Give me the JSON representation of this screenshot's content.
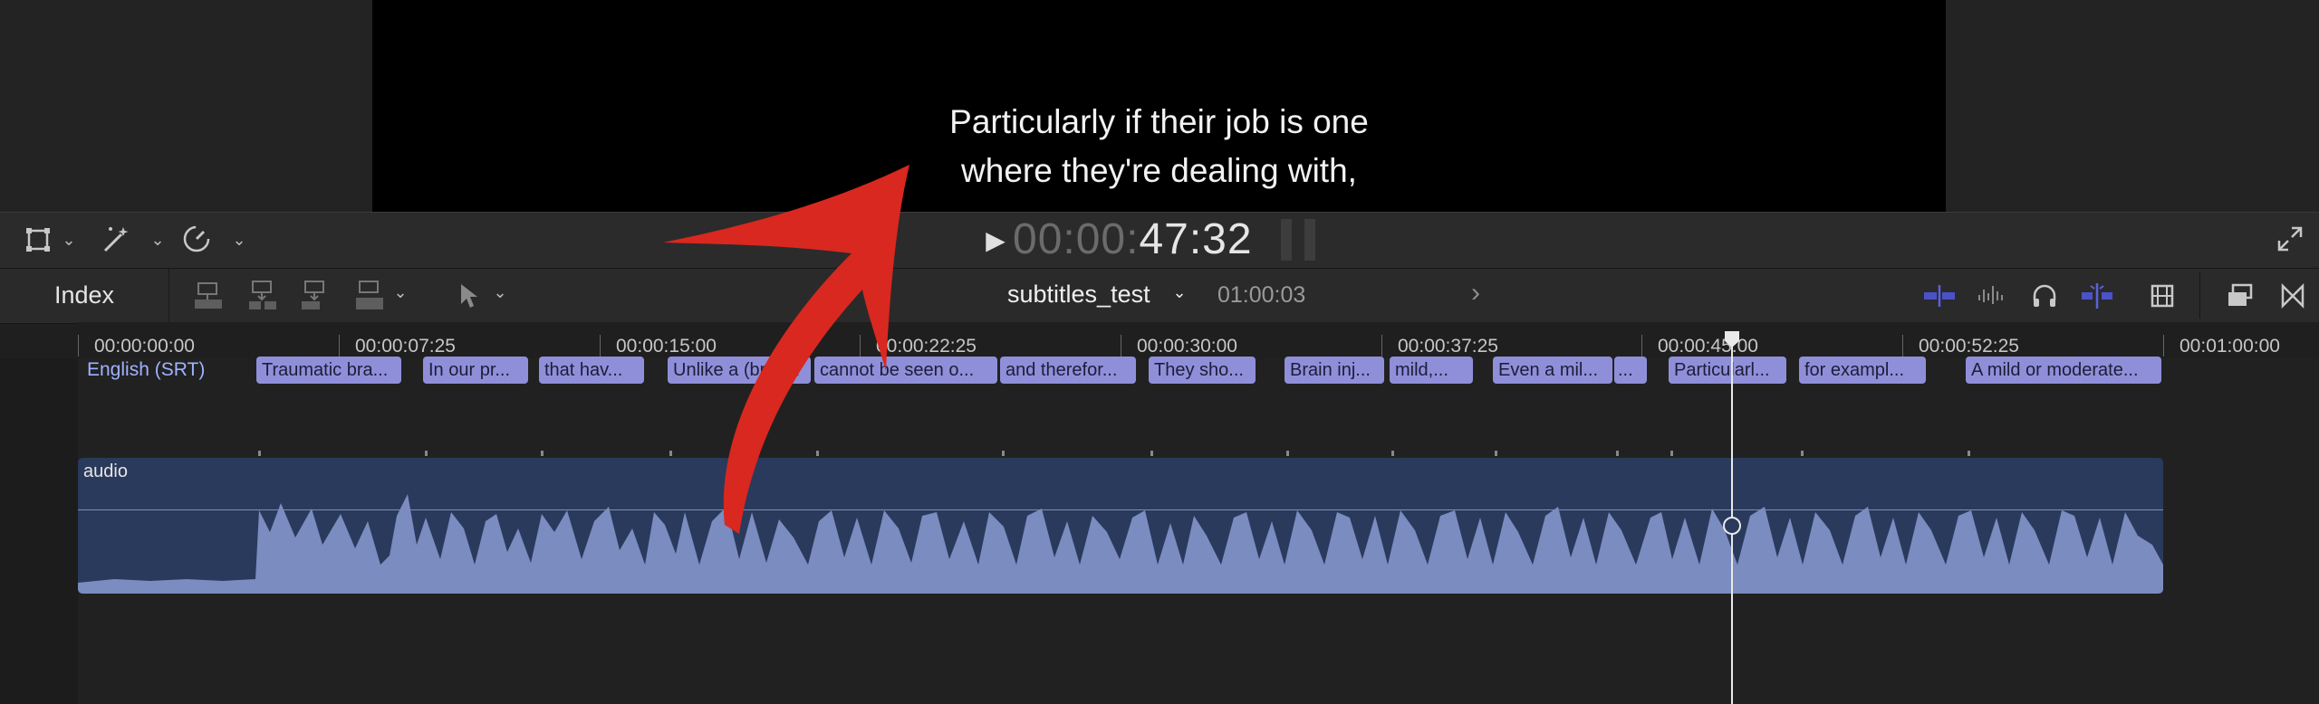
{
  "viewer": {
    "subtitle_line1": "Particularly if their job is one",
    "subtitle_line2": "where they're dealing with,",
    "timecode_dim": "00:00:",
    "timecode_main": "47:32"
  },
  "timeline_toolbar": {
    "index_label": "Index",
    "project_name": "subtitles_test",
    "project_duration": "01:00:03"
  },
  "ruler": {
    "ticks": [
      "00:00:00:00",
      "00:00:07:25",
      "00:00:15:00",
      "00:00:22:25",
      "00:00:30:00",
      "00:00:37:25",
      "00:00:45:00",
      "00:00:52:25",
      "00:01:00:00"
    ]
  },
  "captions": {
    "lane_label": "English (SRT)",
    "items": [
      "Traumatic bra...",
      "In our pr...",
      "that hav...",
      "Unlike a (brok...",
      "cannot be seen o...",
      "and therefor...",
      "They sho...",
      "Brain inj...",
      "mild,...",
      "Even a mil...",
      "...",
      "Particularl...",
      "for exampl...",
      "A mild or moderate..."
    ]
  },
  "audio": {
    "clip_label": "audio"
  },
  "colors": {
    "caption_fill": "#8f8fd9",
    "audio_clip": "#2a3a5c",
    "waveform": "#7a8cc0",
    "annotation_arrow": "#d9281f"
  },
  "icons": [
    "transform-icon",
    "magic-wand-icon",
    "speed-icon",
    "play-icon",
    "fullscreen-icon",
    "connect-clip-icon",
    "insert-clip-icon",
    "append-clip-icon",
    "overwrite-clip-icon",
    "select-tool-icon",
    "snapping-icon",
    "audio-skimming-icon",
    "solo-icon",
    "skimming-icon",
    "clip-appearance-icon",
    "effects-browser-icon",
    "transitions-browser-icon"
  ]
}
